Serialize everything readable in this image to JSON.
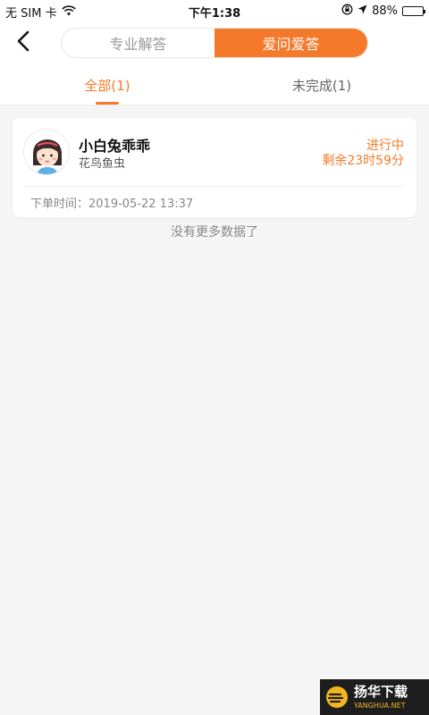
{
  "status_bar": {
    "carrier": "无 SIM 卡",
    "time": "下午1:38",
    "battery": "88%",
    "battery_level": 0.88
  },
  "nav": {
    "back_icon": "chevron-left-icon",
    "segments": [
      {
        "label": "专业解答",
        "active": false
      },
      {
        "label": "爱问爱答",
        "active": true
      }
    ]
  },
  "tabs": [
    {
      "label": "全部(1)",
      "active": true
    },
    {
      "label": "未完成(1)",
      "active": false
    }
  ],
  "orders": [
    {
      "user_name": "小白兔乖乖",
      "category": "花鸟鱼虫",
      "status": "进行中",
      "remaining": "剩余23时59分",
      "order_time_label": "下单时间：",
      "order_time": "2019-05-22 13:37"
    }
  ],
  "no_more_text": "没有更多数据了",
  "watermark": {
    "title": "扬华下载",
    "subtitle": "YANGHUA.NET"
  },
  "colors": {
    "accent": "#f5792a",
    "background": "#f5f5f5"
  }
}
